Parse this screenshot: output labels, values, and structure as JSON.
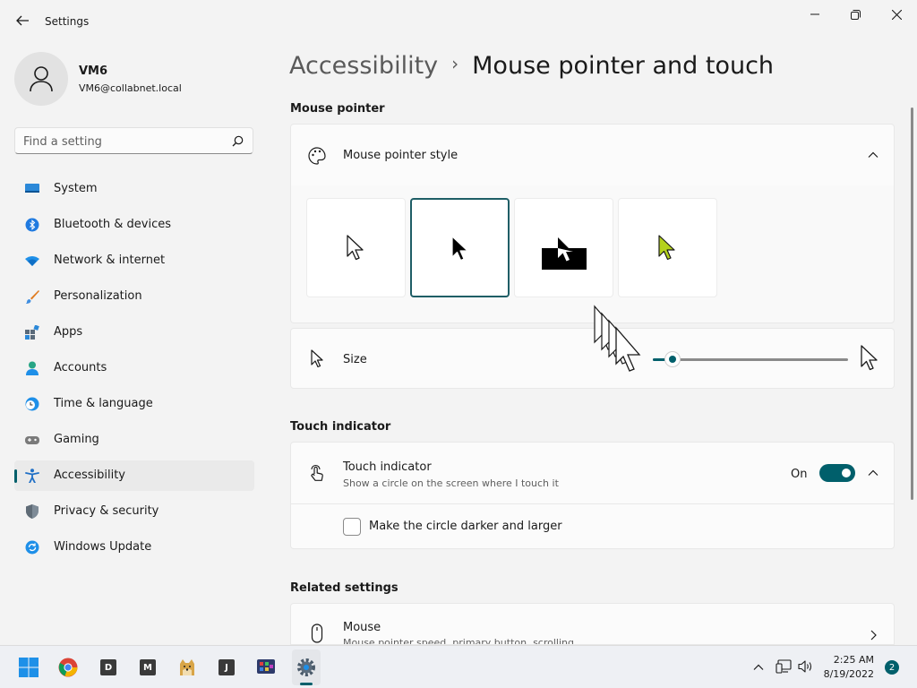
{
  "window": {
    "title": "Settings"
  },
  "user": {
    "name": "VM6",
    "email": "VM6@collabnet.local"
  },
  "search": {
    "placeholder": "Find a setting"
  },
  "sidebar": {
    "items": [
      {
        "label": "System",
        "icon": "monitor-icon"
      },
      {
        "label": "Bluetooth & devices",
        "icon": "bluetooth-icon"
      },
      {
        "label": "Network & internet",
        "icon": "wifi-icon"
      },
      {
        "label": "Personalization",
        "icon": "brush-icon"
      },
      {
        "label": "Apps",
        "icon": "apps-icon"
      },
      {
        "label": "Accounts",
        "icon": "person-icon"
      },
      {
        "label": "Time & language",
        "icon": "clock-globe-icon"
      },
      {
        "label": "Gaming",
        "icon": "gamepad-icon"
      },
      {
        "label": "Accessibility",
        "icon": "accessibility-icon",
        "active": true
      },
      {
        "label": "Privacy & security",
        "icon": "shield-icon"
      },
      {
        "label": "Windows Update",
        "icon": "update-icon"
      }
    ]
  },
  "breadcrumb": {
    "parent": "Accessibility",
    "separator": "›",
    "current": "Mouse pointer and touch"
  },
  "mouse_pointer": {
    "section_title": "Mouse pointer",
    "style_card_title": "Mouse pointer style",
    "styles": [
      "white",
      "black",
      "inverted",
      "custom"
    ],
    "selected_style": "black",
    "custom_color": "#b4d21e",
    "size_label": "Size",
    "size_value": 0.1
  },
  "touch_indicator": {
    "section_title": "Touch indicator",
    "title": "Touch indicator",
    "subtitle": "Show a circle on the screen where I touch it",
    "toggle_label": "On",
    "enabled": true,
    "option_label": "Make the circle darker and larger",
    "option_checked": false
  },
  "related": {
    "section_title": "Related settings",
    "mouse_title": "Mouse",
    "mouse_subtitle": "Mouse pointer speed, primary button, scrolling"
  },
  "taskbar": {
    "apps": [
      "start-icon",
      "chrome-icon",
      "D",
      "M",
      "doge-icon",
      "J",
      "network-tool-icon",
      "settings-icon"
    ],
    "time": "2:25 AM",
    "date": "8/19/2022",
    "notification_count": "2"
  },
  "colors": {
    "accent": "#005f6b"
  }
}
